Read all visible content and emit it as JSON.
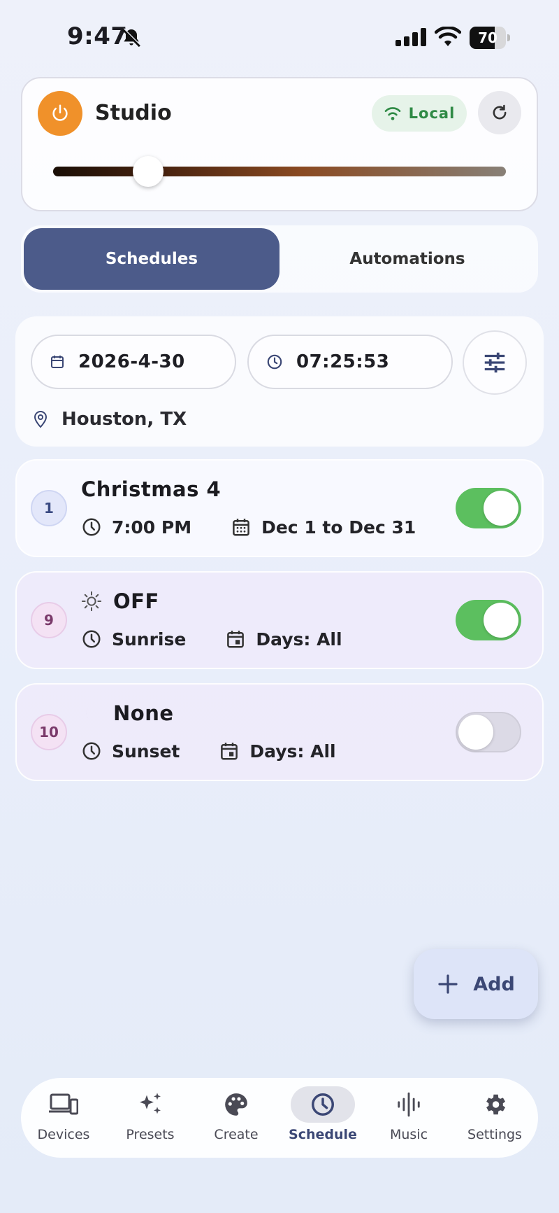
{
  "status_bar": {
    "time": "9:47",
    "battery": "70",
    "battery_level": 0.7
  },
  "device": {
    "name": "Studio",
    "connection_label": "Local",
    "brightness_level": 0.21,
    "colors": {
      "power": "#f0912a",
      "connection": "#2f8a45"
    }
  },
  "tabs": {
    "active": "Schedules",
    "inactive": "Automations"
  },
  "filter": {
    "date": "2026-4-30",
    "time": "07:25:53",
    "location": "Houston, TX"
  },
  "schedules": [
    {
      "index": "1",
      "title": "Christmas 4",
      "time": "7:00 PM",
      "days": "Dec 1 to Dec 31",
      "enabled": true,
      "icon": "none"
    },
    {
      "index": "9",
      "title": "OFF",
      "time": "Sunrise",
      "days": "Days: All",
      "enabled": true,
      "icon": "sun-icon"
    },
    {
      "index": "10",
      "title": "None",
      "time": "Sunset",
      "days": "Days: All",
      "enabled": false,
      "icon": "moon-icon"
    }
  ],
  "fab": {
    "label": "Add"
  },
  "nav": [
    {
      "label": "Devices",
      "icon": "devices-icon",
      "active": false
    },
    {
      "label": "Presets",
      "icon": "sparkle-icon",
      "active": false
    },
    {
      "label": "Create",
      "icon": "palette-icon",
      "active": false
    },
    {
      "label": "Schedule",
      "icon": "clock-icon",
      "active": true
    },
    {
      "label": "Music",
      "icon": "waveform-icon",
      "active": false
    },
    {
      "label": "Settings",
      "icon": "gear-icon",
      "active": false
    }
  ]
}
